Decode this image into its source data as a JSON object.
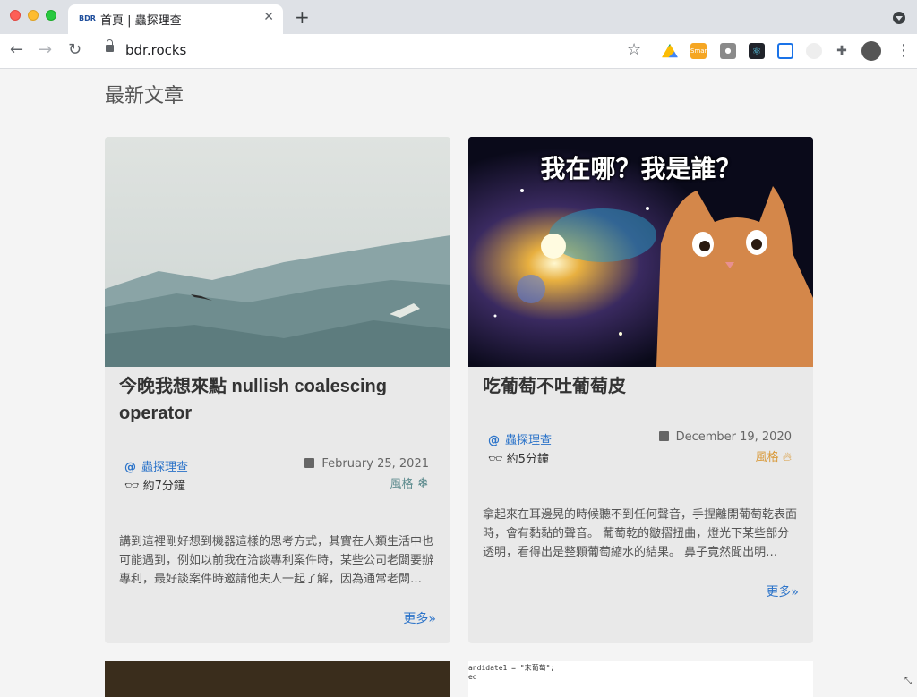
{
  "browser": {
    "tab_title": "首頁 | 蟲探理查",
    "tab_favicon": "BDR",
    "url": "bdr.rocks",
    "icons": [
      "back-icon",
      "forward-icon",
      "reload-icon",
      "lock-icon",
      "star-icon",
      "google-drive-icon",
      "smart-ext-icon",
      "camera-icon",
      "react-devtools-icon",
      "grid-ext-icon",
      "circle-ext-icon",
      "puzzle-icon",
      "avatar",
      "menu-icon"
    ],
    "ext_smart_label": "Smart"
  },
  "page": {
    "section_title": "最新文章",
    "cards": [
      {
        "title": "今晚我想來點 nullish coalescing operator",
        "author": "蟲探理查",
        "reading_time": "約7分鐘",
        "date": "February 25, 2021",
        "style_label": "風格",
        "style_icon": "snowflake-icon",
        "excerpt": "講到這裡剛好想到機器這樣的思考方式，其實在人類生活中也可能遇到，例如以前我在洽談專利案件時，某些公司老闆要辦專利，最好談案件時邀請他夫人一起了解，因為通常老闆…",
        "more": "更多»"
      },
      {
        "title": "吃葡萄不吐葡萄皮",
        "image_caption": "我在哪？我是誰？",
        "author": "蟲探理查",
        "reading_time": "約5分鐘",
        "date": "December 19, 2020",
        "style_label": "風格",
        "style_icon": "fire-icon",
        "excerpt": "拿起來在耳邊晃的時候聽不到任何聲音，手捏離開葡萄乾表面時，會有黏黏的聲音。 葡萄乾的皺摺扭曲，燈光下某些部分透明，看得出是整顆葡萄縮水的結果。 鼻子竟然聞出明…",
        "more": "更多»"
      }
    ],
    "code_snippet_line1": "andidate1 = \"末葡萄\";",
    "code_snippet_line2": "ed"
  },
  "colors": {
    "link": "#2b73c9",
    "style_fire": "#d99a3a",
    "style_snow": "#5e8c8f"
  }
}
